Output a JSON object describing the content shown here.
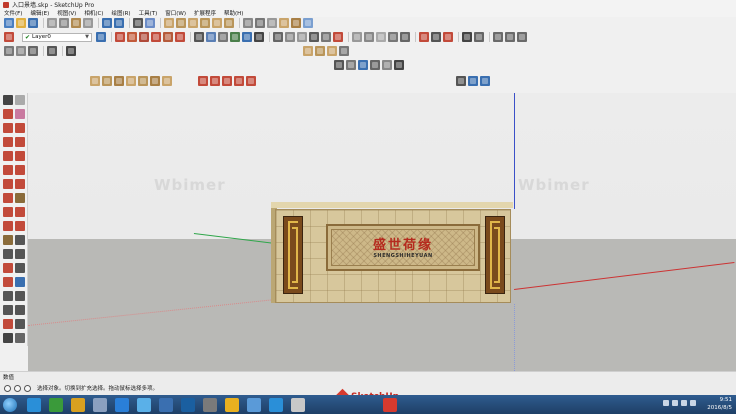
{
  "window": {
    "title": "入口景墙.skp - SketchUp Pro"
  },
  "menu": [
    "文件(F)",
    "编辑(E)",
    "视图(V)",
    "相机(C)",
    "绘图(R)",
    "工具(T)",
    "窗口(W)",
    "扩展程序",
    "帮助(H)"
  ],
  "layer": {
    "current": "Layer0"
  },
  "viewport": {
    "watermark": "Wbimer",
    "plaque_title": "盛世荷缘",
    "plaque_subtitle": "SHENGSHIHEYUAN"
  },
  "status": {
    "measurements_label": "数值",
    "hint": "选择对象。切换到扩充选择。拖动鼠标选择多项。"
  },
  "taskbar": {
    "time": "9:51",
    "date": "2016/8/5"
  },
  "colors": {
    "wall_stone": "#d7c79c",
    "plaque_text": "#b52a1e",
    "deco_gold": "#e0b64a",
    "axis_blue": "#3a50c8",
    "axis_red": "#cc3333",
    "axis_green": "#2fa64a",
    "taskbar": "#2f5c8f"
  }
}
